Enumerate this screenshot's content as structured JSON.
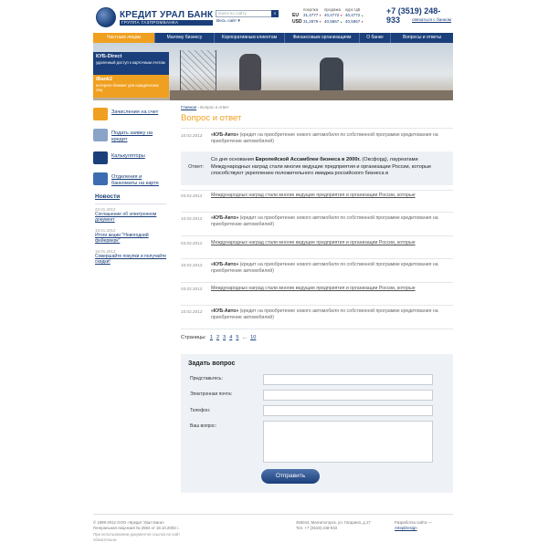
{
  "header": {
    "logo_name": "КРЕДИТ УРАЛ БАНК",
    "logo_sub": "ГРУППА ГАЗПРОМБАНКА",
    "search_placeholder": "поиск по сайту",
    "site_all": "Весь сайт ▾",
    "phone": "+7 (3519) 248-933",
    "contact_link": "связаться с банком"
  },
  "rates": {
    "headers": [
      "покупка",
      "продажа",
      "курс ЦБ"
    ],
    "rows": [
      {
        "cur": "EU",
        "buy": "31,4777",
        "sell": "40,4772",
        "cb": "40,4772"
      },
      {
        "cur": "USD",
        "buy": "31,2879",
        "sell": "40,5867",
        "cb": "40,5867"
      }
    ]
  },
  "nav": {
    "items": [
      {
        "label": "Частным лицам",
        "active": true
      },
      {
        "label": "Малому бизнесу"
      },
      {
        "label": "Корпоративным клиентам"
      },
      {
        "label": "Финансовым организациям"
      },
      {
        "label": "О банке"
      },
      {
        "label": "Вопросы и ответы"
      }
    ]
  },
  "promo": {
    "kub_title": "КУБ-Direct",
    "kub_desc": "удаленный доступ к карточным счетам",
    "ibank_title": "iBank2",
    "ibank_desc": "интернет-банкинг для юридических лиц"
  },
  "sidebar": {
    "items": [
      {
        "label": "Зачисления на счет",
        "icon": "card-icon",
        "color": "#f0a020"
      },
      {
        "label": "Подать заявку на кредит",
        "icon": "document-icon",
        "color": "#8aa4c8"
      },
      {
        "label": "Калькуляторы",
        "icon": "calculator-icon",
        "color": "#1a3f7a"
      },
      {
        "label": "Отделения и банкоматы на карте",
        "icon": "map-icon",
        "color": "#3d6db0"
      }
    ]
  },
  "news": {
    "heading": "Новости",
    "items": [
      {
        "date": "23.01.2012",
        "text": "Соглашение об электронном документ"
      },
      {
        "date": "18.01.2012",
        "text": "Итоги акции \"Новогодний фейерверк\""
      },
      {
        "date": "18.01.2012",
        "text": "Совершайте покупки и получайте скидки!"
      }
    ]
  },
  "main": {
    "breadcrumb_home": "Главная",
    "breadcrumb_current": " › Вопрос и ответ",
    "title": "Вопрос и ответ",
    "first_question": {
      "date": "10.02.2012",
      "strong": "«КУБ-Авто»",
      "text": " (кредит на приобретение нового автомобиля по собственной программе кредитования на приобретение автомобилей)"
    },
    "answer_label": "Ответ:",
    "answer_pre": "Со дня основания ",
    "answer_strong": "Европейской Ассамблеи бизнеса в 2000г.",
    "answer_post": " (Оксфорд), лауреатами Международных наград стали многие ведущие предприятия и организации России, которые способствуют укреплению положительного имиджа российского бизнеса в",
    "questions": [
      {
        "date": "03.02.2012",
        "strong": "",
        "text": "Международных наград стали многие ведущие предприятия и организации России, которые"
      },
      {
        "date": "10.02.2012",
        "strong": "«КУБ-Авто»",
        "text": " (кредит на приобретение нового автомобиля по собственной программе кредитования на приобретение автомобилей)"
      },
      {
        "date": "03.02.2012",
        "strong": "",
        "text": "Международных наград стали многие ведущие предприятия и организации России, которые"
      },
      {
        "date": "10.02.2012",
        "strong": "«КУБ-Авто»",
        "text": " (кредит на приобретение нового автомобиля по собственной программе кредитования на приобретение автомобилей)"
      },
      {
        "date": "03.02.2012",
        "strong": "",
        "text": "Международных наград стали многие ведущие предприятия и организации России, которые"
      },
      {
        "date": "10.02.2012",
        "strong": "«КУБ-Авто»",
        "text": " (кредит на приобретение нового автомобиля по собственной программе кредитования на приобретение автомобилей)"
      }
    ],
    "pages_label": "Страницы:",
    "pages": [
      "1",
      "2",
      "3",
      "4",
      "5",
      "...",
      "10"
    ]
  },
  "form": {
    "title": "Задать вопрос",
    "name_label": "Представьтесь:",
    "email_label": "Электронная почта:",
    "phone_label": "Телефон:",
    "question_label": "Ваш вопрос:",
    "submit": "Отправить"
  },
  "footer": {
    "copyright": "© 1999-2012 ООО «Кредит Урал Банк»",
    "license": "Генеральная лицензия № 2584 от 18.10.2003 г.",
    "note": "При использовании документов ссылка на сайт обязательна.",
    "address": "455044, Магнитогорск, ул. Гагарина, д.17",
    "tel": "Тел. +7 (3519) 248-933",
    "dev_label": "Разработка сайта —",
    "dev_name": "ArtepiDesign"
  }
}
